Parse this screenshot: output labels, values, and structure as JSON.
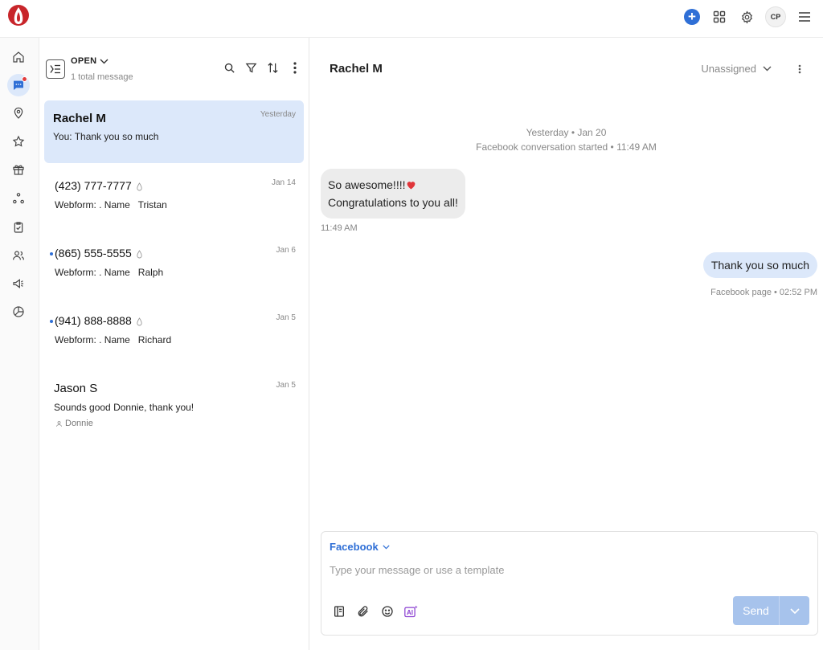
{
  "topbar": {
    "avatar_initials": "CP",
    "icons": [
      "add-icon",
      "apps-grid-icon",
      "gear-icon",
      "menu-icon"
    ]
  },
  "rail": {
    "items": [
      "home-icon",
      "messages-icon",
      "location-icon",
      "star-icon",
      "gift-icon",
      "integrations-icon",
      "tasks-icon",
      "contacts-icon",
      "campaigns-icon",
      "reports-icon"
    ],
    "active": "messages-icon"
  },
  "list": {
    "status": "OPEN",
    "total": "1 total message",
    "conversations": [
      {
        "name": "Rachel M",
        "date": "Yesterday",
        "preview": "You: Thank you so much",
        "selected": true
      },
      {
        "name": "(423) 777-7777",
        "date": "Jan 14",
        "preview": "Webform: . Name   Tristan",
        "unread": false
      },
      {
        "name": "(865) 555-5555",
        "date": "Jan 6",
        "preview": "Webform: . Name   Ralph",
        "unread": true
      },
      {
        "name": "(941) 888-8888",
        "date": "Jan 5",
        "preview": "Webform: . Name   Richard",
        "unread": true
      },
      {
        "name": "Jason S",
        "date": "Jan 5",
        "preview": "Sounds good Donnie, thank you!",
        "assignee": "Donnie"
      }
    ]
  },
  "chat": {
    "title": "Rachel M",
    "assignment": "Unassigned",
    "system_date": "Yesterday • Jan 20",
    "system_started": "Facebook conversation started • 11:49 AM",
    "incoming": {
      "line1": "So awesome!!!!",
      "line2": "Congratulations to you all!",
      "time": "11:49 AM"
    },
    "outgoing": {
      "text": "Thank you so much",
      "meta": "Facebook page • 02:52 PM"
    }
  },
  "composer": {
    "channel": "Facebook",
    "placeholder": "Type your message or use a template",
    "ai_label": "AI",
    "send_label": "Send"
  },
  "colors": {
    "accent": "#2f6fd6",
    "selected_bg": "#dce8fa",
    "send_disabled": "#a7c3ec",
    "brand_red": "#c8262b"
  }
}
